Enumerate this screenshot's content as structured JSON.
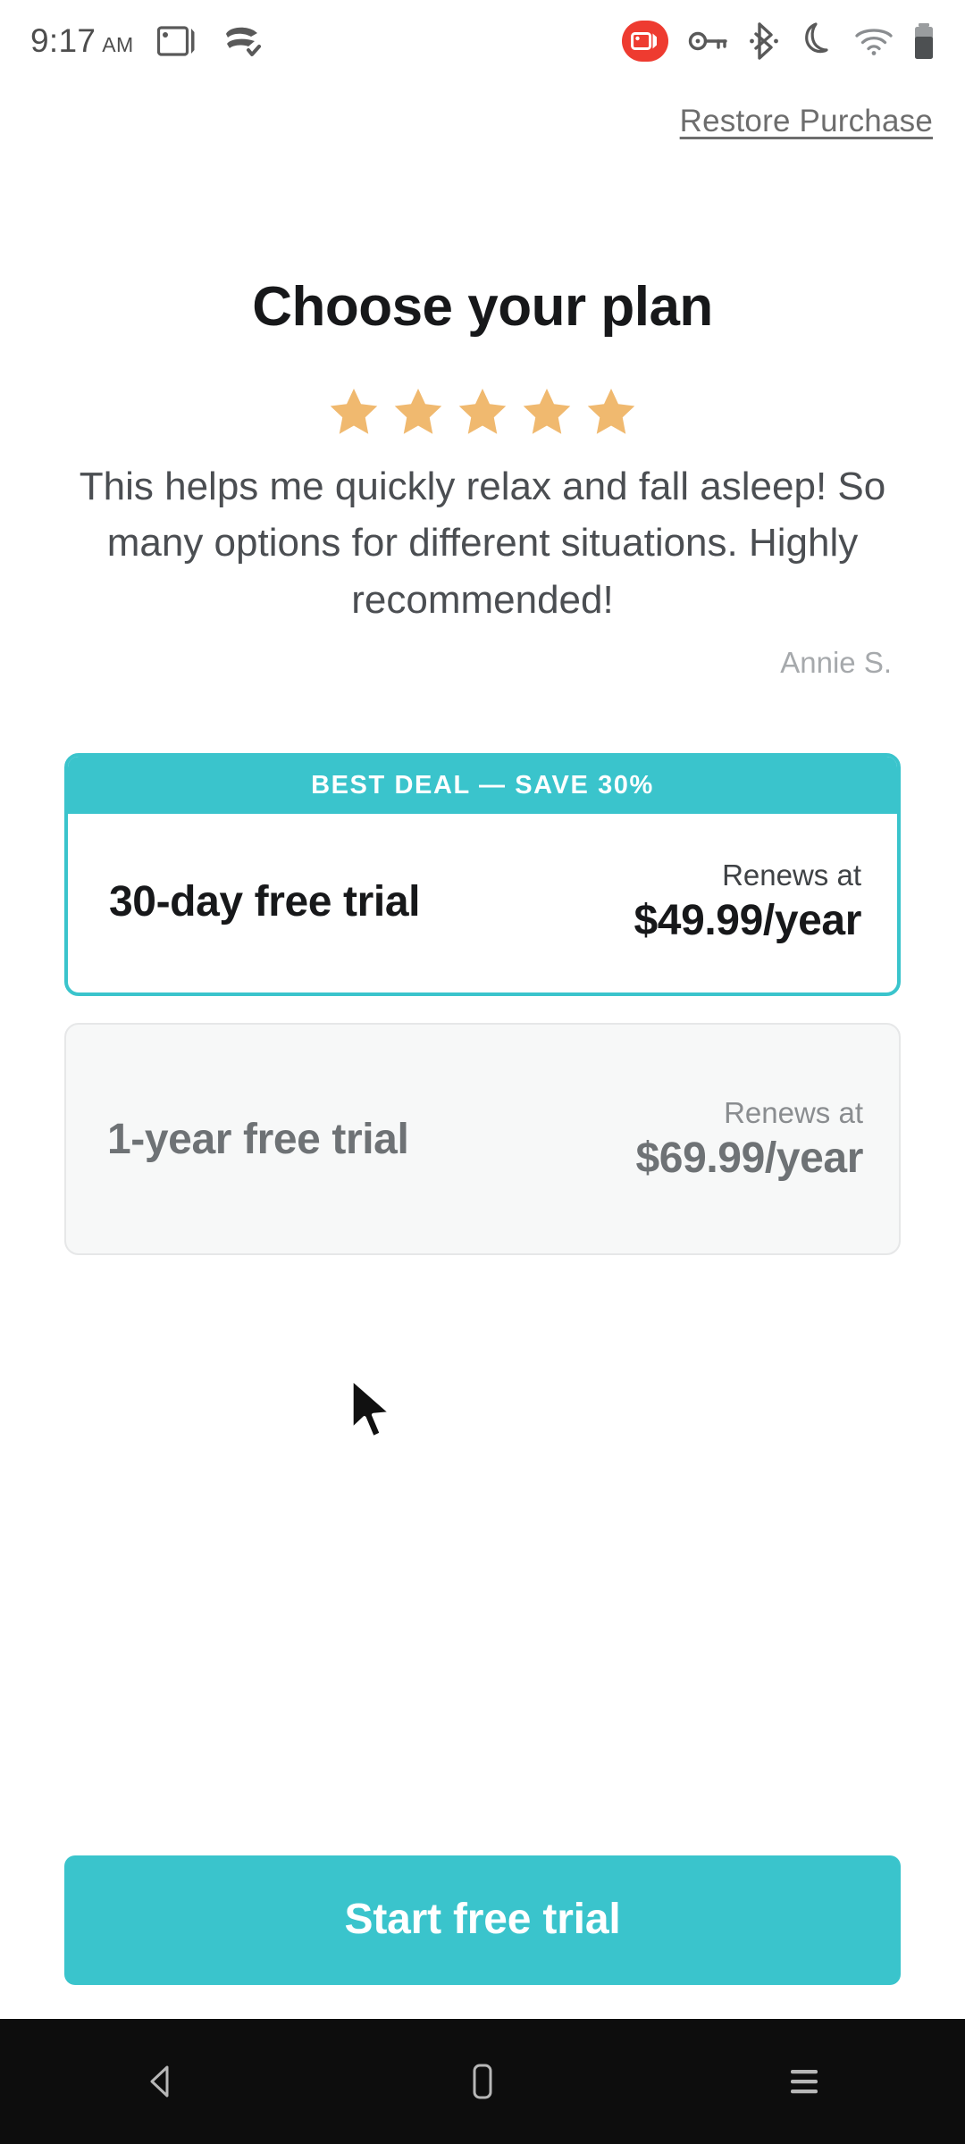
{
  "status_bar": {
    "time": "9:17",
    "meridiem": "AM",
    "left_icons": [
      {
        "name": "screen-cast-icon"
      },
      {
        "name": "data-saver-icon"
      }
    ],
    "right_icons": [
      {
        "name": "screen-recording-icon",
        "color": "#ee3b30"
      },
      {
        "name": "vpn-key-icon"
      },
      {
        "name": "bluetooth-icon"
      },
      {
        "name": "do-not-disturb-moon-icon"
      },
      {
        "name": "wifi-icon"
      },
      {
        "name": "battery-icon"
      }
    ]
  },
  "header": {
    "restore_label": "Restore Purchase"
  },
  "main": {
    "title": "Choose your plan",
    "rating": {
      "stars_filled": 5,
      "stars_total": 5,
      "star_color": "#f0b96f"
    },
    "review_text": "This helps me quickly relax and fall asleep! So many options for different situations. Highly recommended!",
    "review_author": "Annie S.",
    "plans": [
      {
        "id": "plan-30-day",
        "banner": "BEST DEAL — SAVE 30%",
        "name": "30-day free trial",
        "renews_label": "Renews at",
        "price": "$49.99/year",
        "selected": true
      },
      {
        "id": "plan-1-year",
        "banner": null,
        "name": "1-year free trial",
        "renews_label": "Renews at",
        "price": "$69.99/year",
        "selected": false
      }
    ],
    "cta_label": "Start free trial"
  },
  "nav_bar": {
    "back_label": "back-icon",
    "home_label": "home-icon",
    "recents_label": "recents-icon"
  },
  "theme": {
    "accent": "#3ac4cc",
    "star": "#f0b96f",
    "record_red": "#ee3b30",
    "text_dark": "#17181a",
    "text_muted": "#6e7275"
  }
}
